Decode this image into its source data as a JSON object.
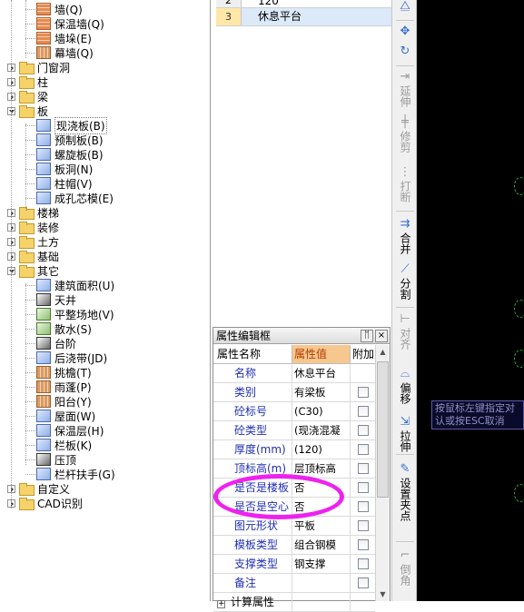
{
  "tree": {
    "items": [
      {
        "label": "墙(Q)",
        "type": "leaf",
        "icon": "wall-icon"
      },
      {
        "label": "保温墙(Q)",
        "type": "leaf",
        "icon": "insulation-wall-icon"
      },
      {
        "label": "墙垛(E)",
        "type": "leaf",
        "icon": "wall-pier-icon"
      },
      {
        "label": "幕墙(Q)",
        "type": "leaf",
        "icon": "curtain-wall-icon"
      },
      {
        "label": "门窗洞",
        "type": "folder"
      },
      {
        "label": "柱",
        "type": "folder"
      },
      {
        "label": "梁",
        "type": "folder"
      },
      {
        "label": "板",
        "type": "folder-open"
      },
      {
        "label": "现浇板(B)",
        "type": "leaf",
        "icon": "cast-slab-icon",
        "selected": true
      },
      {
        "label": "预制板(B)",
        "type": "leaf",
        "icon": "precast-slab-icon"
      },
      {
        "label": "螺旋板(B)",
        "type": "leaf",
        "icon": "spiral-slab-icon"
      },
      {
        "label": "板洞(N)",
        "type": "leaf",
        "icon": "slab-hole-icon"
      },
      {
        "label": "柱帽(V)",
        "type": "leaf",
        "icon": "column-cap-icon"
      },
      {
        "label": "成孔芯模(E)",
        "type": "leaf",
        "icon": "hole-core-mold-icon"
      },
      {
        "label": "楼梯",
        "type": "folder"
      },
      {
        "label": "装修",
        "type": "folder"
      },
      {
        "label": "土方",
        "type": "folder"
      },
      {
        "label": "基础",
        "type": "folder"
      },
      {
        "label": "其它",
        "type": "folder-open"
      },
      {
        "label": "建筑面积(U)",
        "type": "leaf",
        "icon": "building-area-icon"
      },
      {
        "label": "天井",
        "type": "leaf",
        "icon": "patio-icon"
      },
      {
        "label": "平整场地(V)",
        "type": "leaf",
        "icon": "site-leveling-icon"
      },
      {
        "label": "散水(S)",
        "type": "leaf",
        "icon": "apron-icon"
      },
      {
        "label": "台阶",
        "type": "leaf",
        "icon": "steps-icon"
      },
      {
        "label": "后浇带(JD)",
        "type": "leaf",
        "icon": "post-cast-strip-icon"
      },
      {
        "label": "挑檐(T)",
        "type": "leaf",
        "icon": "eave-icon"
      },
      {
        "label": "雨蓬(P)",
        "type": "leaf",
        "icon": "canopy-icon"
      },
      {
        "label": "阳台(Y)",
        "type": "leaf",
        "icon": "balcony-icon"
      },
      {
        "label": "屋面(W)",
        "type": "leaf",
        "icon": "roof-icon"
      },
      {
        "label": "保温层(H)",
        "type": "leaf",
        "icon": "insulation-layer-icon"
      },
      {
        "label": "栏板(K)",
        "type": "leaf",
        "icon": "parapet-icon"
      },
      {
        "label": "压顶",
        "type": "leaf",
        "icon": "coping-icon"
      },
      {
        "label": "栏杆扶手(G)",
        "type": "leaf",
        "icon": "railing-icon"
      },
      {
        "label": "自定义",
        "type": "folder"
      },
      {
        "label": "CAD识别",
        "type": "folder"
      }
    ]
  },
  "list": {
    "rows": [
      {
        "index": "2",
        "value": "120"
      },
      {
        "index": "3",
        "value": "休息平台",
        "selected": true
      }
    ]
  },
  "prop_panel": {
    "title": "属性编辑框",
    "pin_label": "ᛖ",
    "close_label": "×",
    "headers": {
      "name": "属性名称",
      "value": "属性值",
      "extra": "附加"
    },
    "rows": [
      {
        "name": "名称",
        "value": "休息平台",
        "check": false
      },
      {
        "name": "类别",
        "value": "有梁板",
        "check": true
      },
      {
        "name": "砼标号",
        "value": "(C30)",
        "check": true
      },
      {
        "name": "砼类型",
        "value": "(现浇混凝",
        "check": true
      },
      {
        "name": "厚度(mm)",
        "value": "(120)",
        "check": true
      },
      {
        "name": "顶标高(m)",
        "value": "层顶标高",
        "check": true
      },
      {
        "name": "是否是楼板",
        "value": "否",
        "check": true
      },
      {
        "name": "是否是空心",
        "value": "否",
        "check": true
      },
      {
        "name": "图元形状",
        "value": "平板",
        "check": true
      },
      {
        "name": "模板类型",
        "value": "组合钢模",
        "check": true
      },
      {
        "name": "支撑类型",
        "value": "钢支撑",
        "check": true
      },
      {
        "name": "备注",
        "value": "",
        "check": true
      },
      {
        "name": "计算属性",
        "value": "",
        "check": false,
        "expander": "+"
      }
    ]
  },
  "toolbar": {
    "buttons": [
      {
        "label": "",
        "icon": "mirror-icon",
        "glyph": "⧋"
      },
      {
        "label": "",
        "icon": "move-icon",
        "glyph": "✥"
      },
      {
        "label": "",
        "icon": "rotate-icon",
        "glyph": "↻"
      },
      {
        "label": "延伸",
        "icon": "extend-icon",
        "glyph": "⇥",
        "dim": true
      },
      {
        "label": "修剪",
        "icon": "trim-icon",
        "glyph": "╪",
        "dim": true
      },
      {
        "label": "打断",
        "icon": "break-icon",
        "glyph": "⋮",
        "dim": true
      },
      {
        "label": "合并",
        "icon": "merge-icon",
        "glyph": "⇉"
      },
      {
        "label": "分割",
        "icon": "split-icon",
        "glyph": "⟋"
      },
      {
        "label": "对齐",
        "icon": "align-icon",
        "glyph": "⊢",
        "dim": true
      },
      {
        "label": "偏移",
        "icon": "offset-icon",
        "glyph": "⌓"
      },
      {
        "label": "拉伸",
        "icon": "stretch-icon",
        "glyph": "⇲"
      },
      {
        "label": "设置夹点",
        "icon": "set-grip-icon",
        "glyph": "✎"
      },
      {
        "label": "倒角",
        "icon": "chamfer-icon",
        "glyph": "⌐",
        "dim": true
      }
    ]
  },
  "canvas": {
    "tooltip_line1": "按鼠标左键指定对",
    "tooltip_line2": "认或按ESC取消"
  },
  "colors": {
    "highlight_ellipse": "#ee22ee",
    "canvas_bg": "#000000",
    "value_header_bg": "#f6c78e"
  }
}
